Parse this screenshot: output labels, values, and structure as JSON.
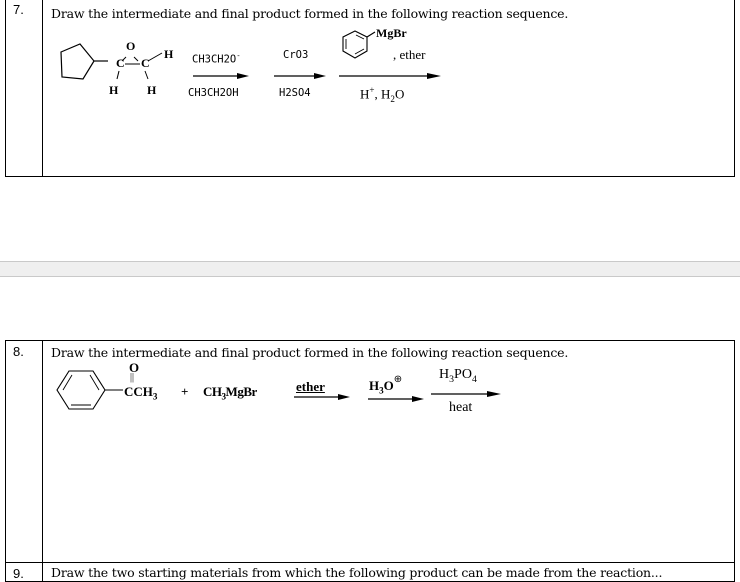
{
  "questions": [
    {
      "number": "7.",
      "prompt": "Draw the intermediate and final product formed in the following reaction sequence.",
      "reactant": {
        "structure": "cyclopentyl epoxide",
        "labels": {
          "oxygen": "O",
          "carbon1": "C",
          "carbon2": "C",
          "h_top_right": "H",
          "h_bottom_left": "H",
          "h_bottom_right": "H"
        }
      },
      "steps": [
        {
          "above": "CH3CH2O",
          "above_charge": "-",
          "below": "CH3CH2OH"
        },
        {
          "above": "CrO3",
          "below": "H2SO4"
        },
        {
          "above_group": "MgBr",
          "above_suffix": ", ether",
          "below": "H+, H2O"
        }
      ]
    },
    {
      "number": "8.",
      "prompt": "Draw the intermediate and final product formed in the following reaction sequence.",
      "reactant": {
        "structure": "acetophenone",
        "carbonyl_o": "O",
        "double_bond": "||",
        "group": "CCH3",
        "plus": "+",
        "reagent": "CH3MgBr"
      },
      "steps": [
        {
          "above": "ether"
        },
        {
          "above": "H3O",
          "above_charge": "+"
        },
        {
          "above": "H3PO4",
          "below": "heat"
        }
      ]
    },
    {
      "number": "9.",
      "prompt": "Draw the two starting materials from which the following product can be made from the reaction..."
    }
  ]
}
